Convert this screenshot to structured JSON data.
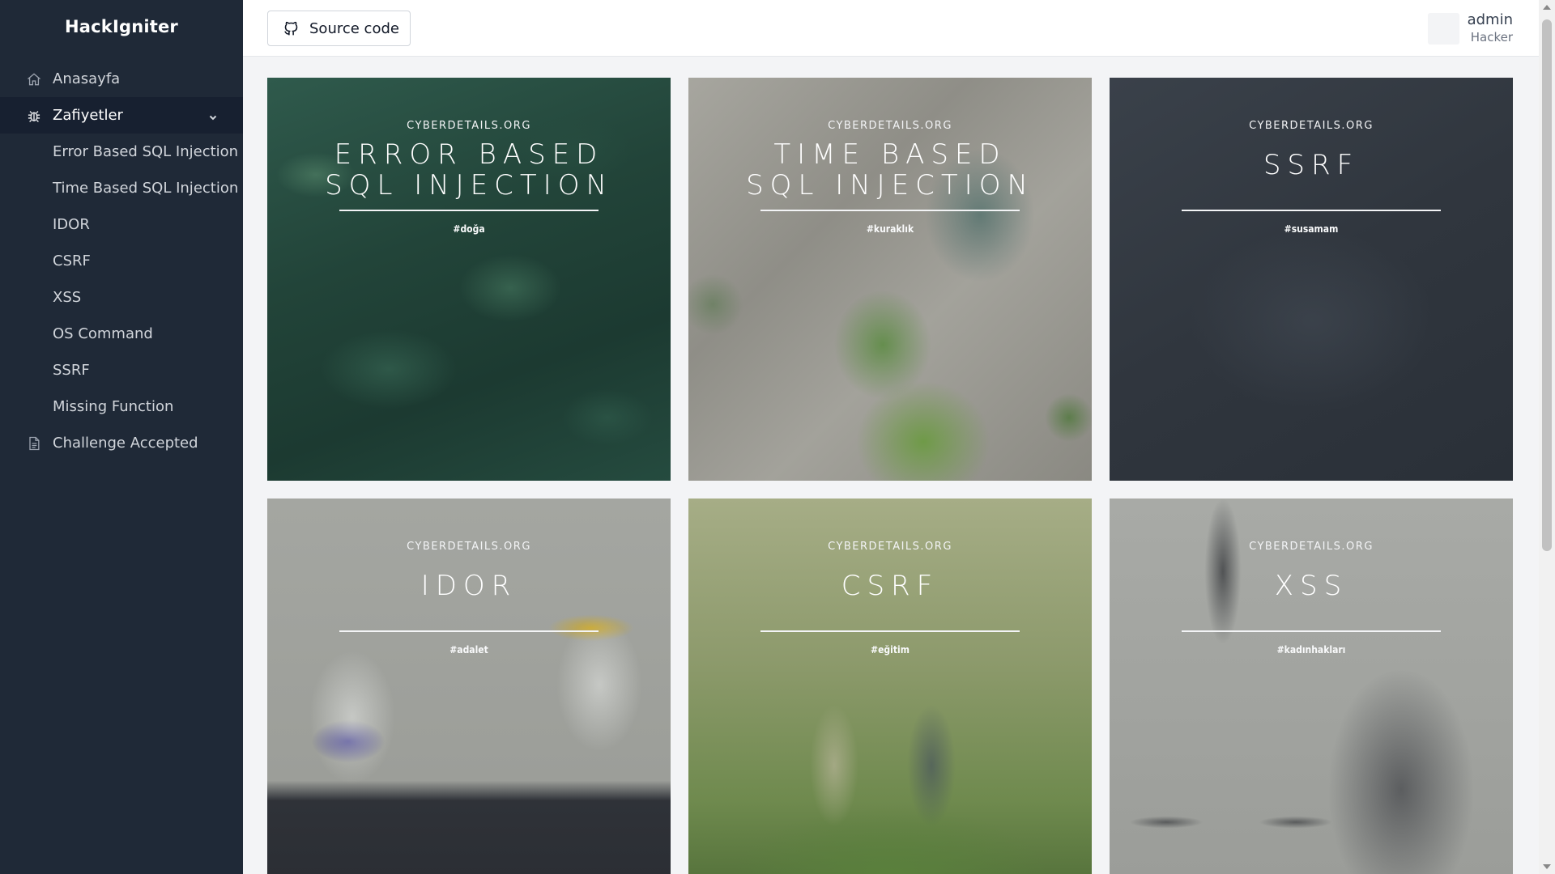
{
  "sidebar": {
    "brand": "HackIgniter",
    "nav": [
      {
        "label": "Anasayfa",
        "icon": "home-icon"
      },
      {
        "label": "Zafiyetler",
        "icon": "bug-icon",
        "expanded": true
      }
    ],
    "sub_items": [
      {
        "label": "Error Based SQL Injection"
      },
      {
        "label": "Time Based SQL Injection"
      },
      {
        "label": "IDOR"
      },
      {
        "label": "CSRF"
      },
      {
        "label": "XSS"
      },
      {
        "label": "OS Command"
      },
      {
        "label": "SSRF"
      },
      {
        "label": "Missing Function"
      }
    ],
    "bottom": {
      "label": "Challenge Accepted",
      "icon": "document-icon"
    }
  },
  "header": {
    "source_label": "Source code",
    "source_icon": "github-icon",
    "user_name": "admin",
    "user_role": "Hacker"
  },
  "cards": [
    {
      "site": "CYBERDETAILS.ORG",
      "title": "ERROR BASED\nSQL INJECTION",
      "tag": "#doğa",
      "bg": "forest"
    },
    {
      "site": "CYBERDETAILS.ORG",
      "title": "TIME BASED\nSQL INJECTION",
      "tag": "#kuraklık",
      "bg": "aerial-lake"
    },
    {
      "site": "CYBERDETAILS.ORG",
      "title": "SSRF",
      "tag": "#susamam",
      "bg": "dark-sand"
    },
    {
      "site": "CYBERDETAILS.ORG",
      "title": "IDOR",
      "tag": "#adalet",
      "bg": "glasses"
    },
    {
      "site": "CYBERDETAILS.ORG",
      "title": "CSRF",
      "tag": "#eğitim",
      "bg": "children-reading"
    },
    {
      "site": "CYBERDETAILS.ORG",
      "title": "XSS",
      "tag": "#kadınhakları",
      "bg": "justice-statue"
    }
  ],
  "colors": {
    "sidebar_bg": "#1f2937",
    "sidebar_active": "#172030",
    "header_bg": "#ffffff",
    "page_bg": "#f3f4f6"
  }
}
